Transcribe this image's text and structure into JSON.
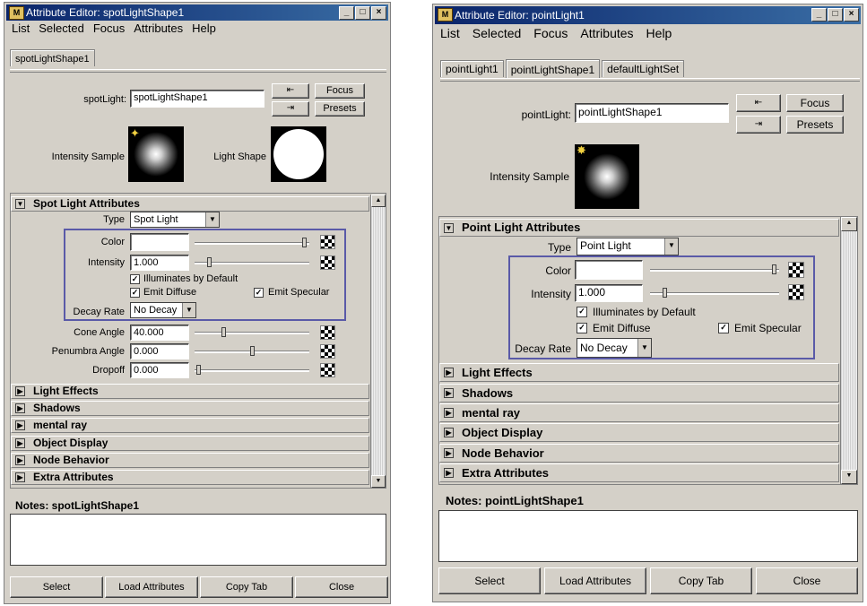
{
  "left": {
    "title": "Attribute Editor: spotLightShape1",
    "menu": [
      "List",
      "Selected",
      "Focus",
      "Attributes",
      "Help"
    ],
    "tabs": [
      "spotLightShape1"
    ],
    "node_label": "spotLight:",
    "node_value": "spotLightShape1",
    "focus_label": "Focus",
    "presets_label": "Presets",
    "intensity_sample_label": "Intensity Sample",
    "light_shape_label": "Light Shape",
    "section_title": "Spot Light Attributes",
    "type_label": "Type",
    "type_value": "Spot Light",
    "color_label": "Color",
    "intensity_label": "Intensity",
    "intensity_value": "1.000",
    "illuminates_label": "Illuminates by Default",
    "emit_diffuse_label": "Emit Diffuse",
    "emit_specular_label": "Emit Specular",
    "decay_label": "Decay Rate",
    "decay_value": "No Decay",
    "cone_label": "Cone Angle",
    "cone_value": "40.000",
    "penumbra_label": "Penumbra Angle",
    "penumbra_value": "0.000",
    "dropoff_label": "Dropoff",
    "dropoff_value": "0.000",
    "sections": [
      "Light Effects",
      "Shadows",
      "mental ray",
      "Object Display",
      "Node Behavior",
      "Extra Attributes"
    ],
    "notes_title": "Notes: spotLightShape1",
    "buttons": [
      "Select",
      "Load Attributes",
      "Copy Tab",
      "Close"
    ]
  },
  "right": {
    "title": "Attribute Editor: pointLight1",
    "menu": [
      "List",
      "Selected",
      "Focus",
      "Attributes",
      "Help"
    ],
    "tabs": [
      "pointLight1",
      "pointLightShape1",
      "defaultLightSet"
    ],
    "node_label": "pointLight:",
    "node_value": "pointLightShape1",
    "focus_label": "Focus",
    "presets_label": "Presets",
    "intensity_sample_label": "Intensity Sample",
    "section_title": "Point Light Attributes",
    "type_label": "Type",
    "type_value": "Point Light",
    "color_label": "Color",
    "intensity_label": "Intensity",
    "intensity_value": "1.000",
    "illuminates_label": "Illuminates by Default",
    "emit_diffuse_label": "Emit Diffuse",
    "emit_specular_label": "Emit Specular",
    "decay_label": "Decay Rate",
    "decay_value": "No Decay",
    "sections": [
      "Light Effects",
      "Shadows",
      "mental ray",
      "Object Display",
      "Node Behavior",
      "Extra Attributes"
    ],
    "notes_title": "Notes: pointLightShape1",
    "buttons": [
      "Select",
      "Load Attributes",
      "Copy Tab",
      "Close"
    ]
  },
  "colors": {
    "titlebar": "#0a246a",
    "window_bg": "#d4d0c8",
    "highlight_box": "#5a5aa8"
  }
}
